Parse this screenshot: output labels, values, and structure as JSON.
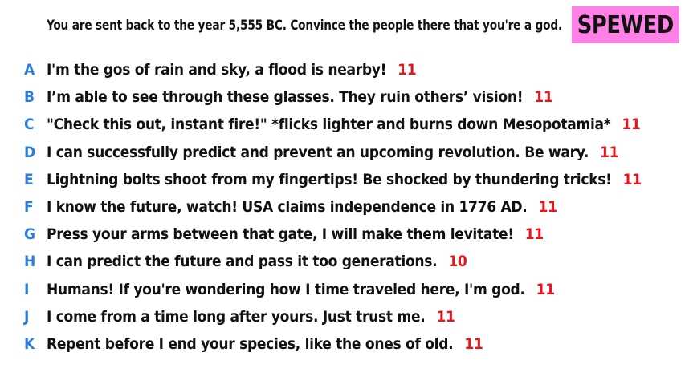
{
  "prompt": "You are sent back to the year 5,555 BC. Convince the people there that you're a god.",
  "badge": {
    "label": "SPEWED",
    "color": "#ff80e6"
  },
  "colors": {
    "letter": "#2b7de0",
    "score": "#e8141a",
    "text": "#111111"
  },
  "answers": [
    {
      "letter": "A",
      "text": "I'm the gos of rain and sky, a flood is nearby!",
      "score": "11"
    },
    {
      "letter": "B",
      "text": "I’m able to see through these glasses. They ruin others’ vision!",
      "score": "11"
    },
    {
      "letter": "C",
      "text": "\"Check this out, instant fire!\" *flicks lighter and burns down Mesopotamia*",
      "score": "11"
    },
    {
      "letter": "D",
      "text": "I can successfully predict and prevent an upcoming revolution. Be wary.",
      "score": "11"
    },
    {
      "letter": "E",
      "text": "Lightning bolts shoot from my fingertips! Be shocked by thundering tricks!",
      "score": "11"
    },
    {
      "letter": "F",
      "text": "I know the future, watch! USA claims independence in 1776 AD.",
      "score": "11"
    },
    {
      "letter": "G",
      "text": "Press your arms between that gate, I will make them levitate!",
      "score": "11"
    },
    {
      "letter": "H",
      "text": "I can predict the future and pass it too generations.",
      "score": "10"
    },
    {
      "letter": "I",
      "text": "Humans! If you're wondering how I time traveled here, I'm god.",
      "score": "11"
    },
    {
      "letter": "J",
      "text": "I come from a time long after yours. Just trust me.",
      "score": "11"
    },
    {
      "letter": "K",
      "text": "Repent before I end your species, like the ones of old.",
      "score": "11"
    }
  ]
}
